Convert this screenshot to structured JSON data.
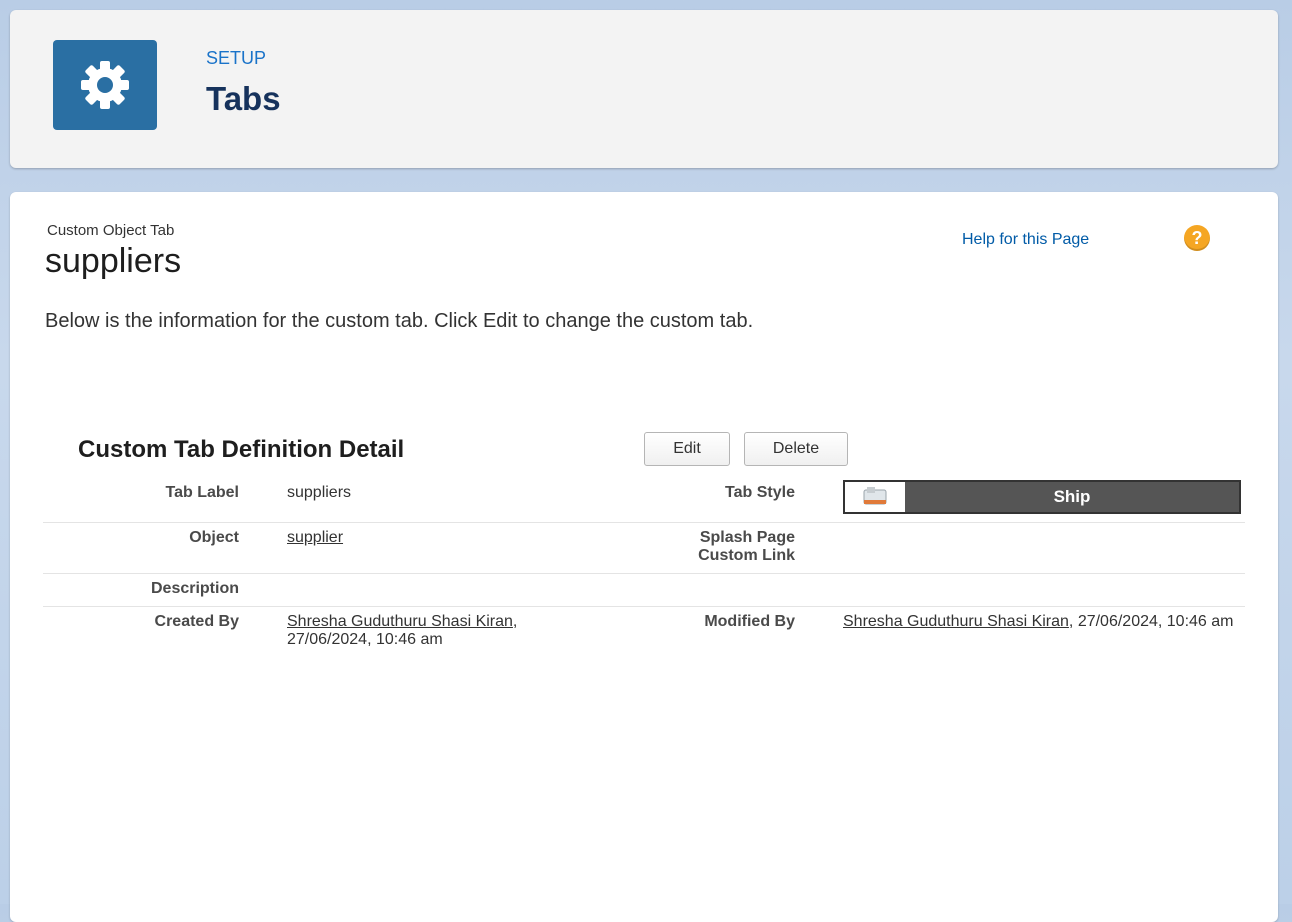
{
  "header": {
    "setup_label": "SETUP",
    "title": "Tabs",
    "icon": "gear-icon"
  },
  "record": {
    "type_label": "Custom Object Tab",
    "name": "suppliers",
    "help_link": "Help for this Page",
    "help_icon": "question-icon",
    "intro": "Below is the information for the custom tab. Click Edit to change the custom tab."
  },
  "detail": {
    "section_title": "Custom Tab Definition Detail",
    "edit_label": "Edit",
    "delete_label": "Delete",
    "tab_label_label": "Tab Label",
    "tab_label_value": "suppliers",
    "tab_style_label": "Tab Style",
    "tab_style_value": "Ship",
    "tab_style_icon": "ship-icon",
    "object_label": "Object",
    "object_value": "supplier",
    "splash_label_1": "Splash Page",
    "splash_label_2": "Custom Link",
    "description_label": "Description",
    "created_by_label": "Created By",
    "created_by_name": "Shresha Guduthuru Shasi Kiran",
    "created_by_date": ", 27/06/2024, 10:46 am",
    "modified_by_label": "Modified By",
    "modified_by_name": "Shresha Guduthuru Shasi Kiran",
    "modified_by_date": ", 27/06/2024, 10:46 am"
  },
  "colors": {
    "header_icon_bg": "#2a6fa3",
    "link_blue": "#015ba7",
    "help_orange": "#f5a623",
    "tab_style_dark": "#555555"
  }
}
